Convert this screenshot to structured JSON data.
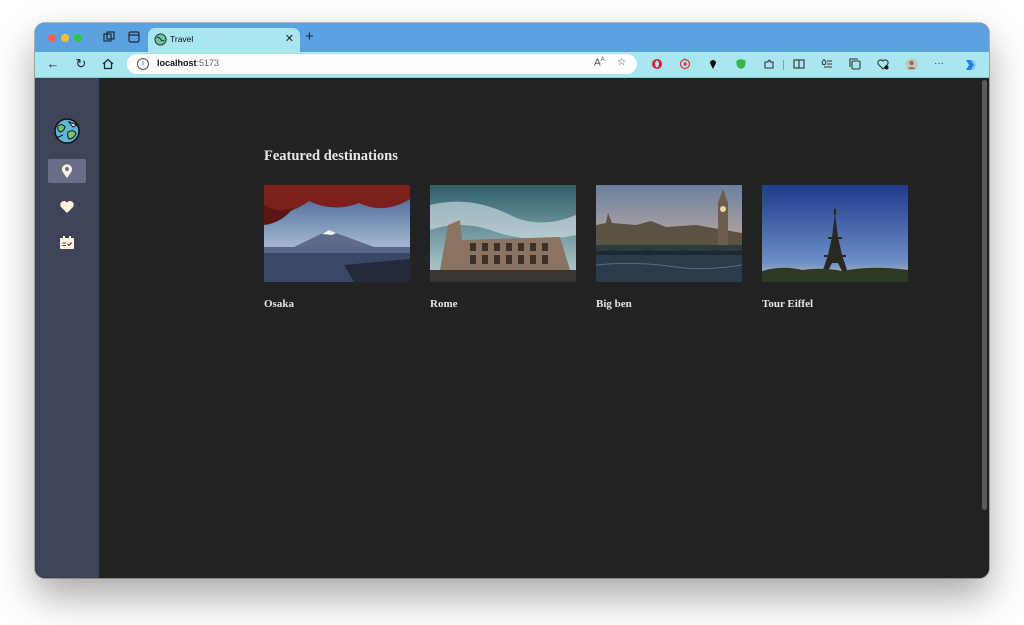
{
  "browser": {
    "tab": {
      "title": "Travel"
    },
    "address": {
      "host": "localhost",
      "port": ":5173"
    },
    "colors": {
      "tabbar": "#5aa2e0",
      "toolbar": "#a8e6f0"
    }
  },
  "sidebar": {
    "items": [
      {
        "name": "map-pin-icon",
        "active": true
      },
      {
        "name": "heart-icon",
        "active": false
      },
      {
        "name": "calendar-check-icon",
        "active": false
      }
    ]
  },
  "main": {
    "title": "Featured destinations",
    "cards": [
      {
        "label": "Osaka",
        "image": "mountain-lake-photo"
      },
      {
        "label": "Rome",
        "image": "colosseum-photo"
      },
      {
        "label": "Big ben",
        "image": "westminster-bridge-photo"
      },
      {
        "label": "Tour Eiffel",
        "image": "eiffel-tower-photo"
      }
    ]
  }
}
